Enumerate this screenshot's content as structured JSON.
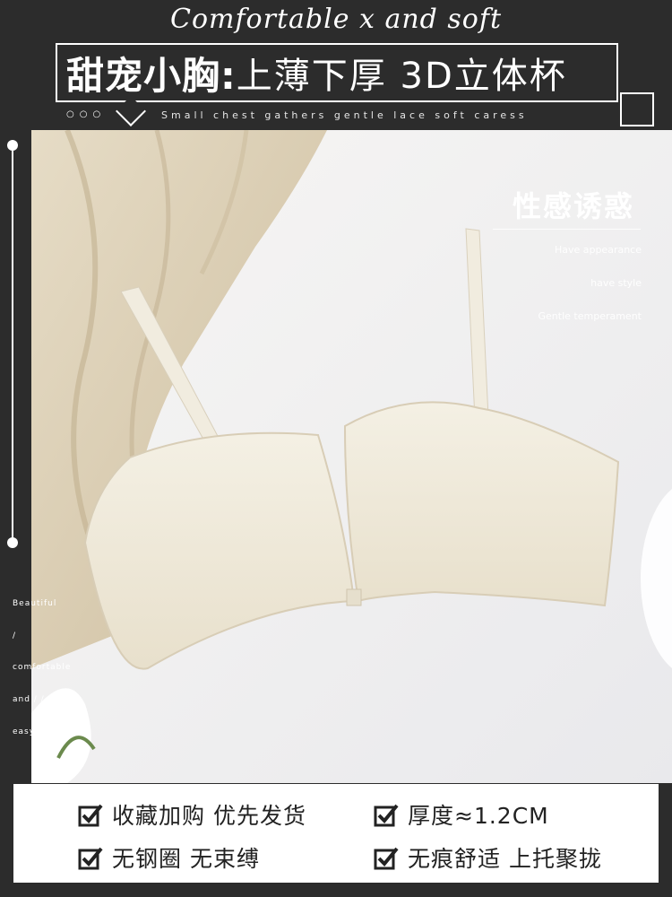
{
  "header": {
    "script_text": "Comfortable x and soft",
    "title_bold": "甜宠小胸:",
    "title_light": "上薄下厚 3D立体杯",
    "subtitle": "Small chest gathers gentle lace soft caress",
    "dots": "○○○"
  },
  "overlay": {
    "heading": "性感诱惑",
    "lines": [
      "Have appearance",
      "have style",
      "Gentle temperament"
    ]
  },
  "side_text": [
    "Beautiful",
    "/",
    "comfortable",
    "and / /",
    "easy to wear"
  ],
  "features": [
    {
      "text": "收藏加购 优先发货"
    },
    {
      "text": "厚度≈1.2CM"
    },
    {
      "text": "无钢圈 无束缚"
    },
    {
      "text": "无痕舒适 上托聚拢"
    }
  ],
  "colors": {
    "background": "#2c2c2c",
    "product": "#f1ecdf",
    "fabric": "#dccfb6"
  },
  "icons": [
    "check-icon"
  ]
}
